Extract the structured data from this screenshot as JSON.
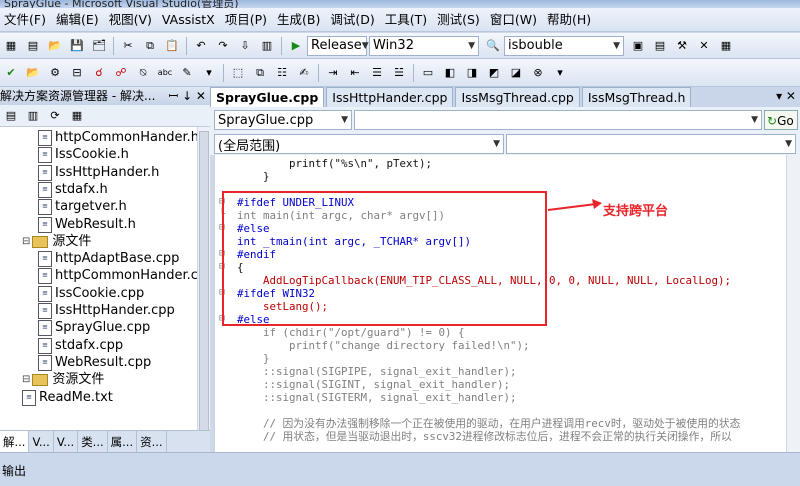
{
  "window": {
    "title": "SprayGlue - Microsoft Visual Studio(管理员)"
  },
  "menu": [
    "文件(F)",
    "编辑(E)",
    "视图(V)",
    "VAssistX",
    "项目(P)",
    "生成(B)",
    "调试(D)",
    "工具(T)",
    "测试(S)",
    "窗口(W)",
    "帮助(H)"
  ],
  "toolbar": {
    "config": "Release",
    "platform": "Win32",
    "find_text": "isbouble"
  },
  "solution_explorer": {
    "title": "解决方案资源管理器 - 解决...",
    "pin": "ꟷ ↓ ✕",
    "items": [
      {
        "label": "httpCommonHander.h",
        "kind": "file",
        "level": 2
      },
      {
        "label": "IssCookie.h",
        "kind": "file",
        "level": 2
      },
      {
        "label": "IssHttpHander.h",
        "kind": "file",
        "level": 2
      },
      {
        "label": "stdafx.h",
        "kind": "file",
        "level": 2
      },
      {
        "label": "targetver.h",
        "kind": "file",
        "level": 2
      },
      {
        "label": "WebResult.h",
        "kind": "file",
        "level": 2
      },
      {
        "label": "源文件",
        "kind": "folder",
        "level": 1
      },
      {
        "label": "httpAdaptBase.cpp",
        "kind": "file",
        "level": 2
      },
      {
        "label": "httpCommonHander.cpp",
        "kind": "file",
        "level": 2
      },
      {
        "label": "IssCookie.cpp",
        "kind": "file",
        "level": 2
      },
      {
        "label": "IssHttpHander.cpp",
        "kind": "file",
        "level": 2
      },
      {
        "label": "SprayGlue.cpp",
        "kind": "file",
        "level": 2
      },
      {
        "label": "stdafx.cpp",
        "kind": "file",
        "level": 2
      },
      {
        "label": "WebResult.cpp",
        "kind": "file",
        "level": 2
      },
      {
        "label": "资源文件",
        "kind": "folder",
        "level": 1
      },
      {
        "label": "ReadMe.txt",
        "kind": "file",
        "level": 1
      }
    ],
    "tabs": [
      "解...",
      "V...",
      "V...",
      "类...",
      "属...",
      "资..."
    ]
  },
  "doc_tabs": [
    "SprayGlue.cpp",
    "IssHttpHander.cpp",
    "IssMsgThread.cpp",
    "IssMsgThread.h"
  ],
  "nav": {
    "file": "SprayGlue.cpp",
    "scope": "(全局范围)",
    "go": "Go"
  },
  "code_lines": [
    {
      "t": "        printf(\"%s\\n\", pText);",
      "c": "cb"
    },
    {
      "t": "    }",
      "c": "cb"
    },
    {
      "t": "",
      "c": "cb"
    },
    {
      "t": "#ifdef UNDER_LINUX",
      "c": "pp"
    },
    {
      "t": "int main(int argc, char* argv[])",
      "c": "cm"
    },
    {
      "t": "#else",
      "c": "pp"
    },
    {
      "t": "int _tmain(int argc, _TCHAR* argv[])",
      "c": "pp"
    },
    {
      "t": "#endif",
      "c": "pp"
    },
    {
      "t": "{",
      "c": "cb"
    },
    {
      "t": "    AddLogTipCallback(ENUM_TIP_CLASS_ALL, NULL, 0, 0, NULL, NULL, LocalLog);",
      "c": "red"
    },
    {
      "t": "#ifdef WIN32",
      "c": "pp"
    },
    {
      "t": "    setLang();",
      "c": "red"
    },
    {
      "t": "#else",
      "c": "pp"
    },
    {
      "t": "    if (chdir(\"/opt/guard\") != 0) {",
      "c": "cm"
    },
    {
      "t": "        printf(\"change directory failed!\\n\");",
      "c": "cm"
    },
    {
      "t": "    }",
      "c": "cm"
    },
    {
      "t": "    ::signal(SIGPIPE, signal_exit_handler);",
      "c": "cm"
    },
    {
      "t": "    ::signal(SIGINT, signal_exit_handler);",
      "c": "cm"
    },
    {
      "t": "    ::signal(SIGTERM, signal_exit_handler);",
      "c": "cm"
    },
    {
      "t": "",
      "c": "cm"
    },
    {
      "t": "    // 因为没有办法强制移除一个正在被使用的驱动，在用户进程调用recv时，驱动处于被使用的状态",
      "c": "cm"
    },
    {
      "t": "    // 用状态，但是当驱动退出时，sscv32进程修改标志位后，进程不会正常的执行关闭操作，所以",
      "c": "cm"
    }
  ],
  "annotation": {
    "text": "支持跨平台",
    "color": "#e8252b"
  },
  "output_panel": {
    "label": "输出"
  }
}
